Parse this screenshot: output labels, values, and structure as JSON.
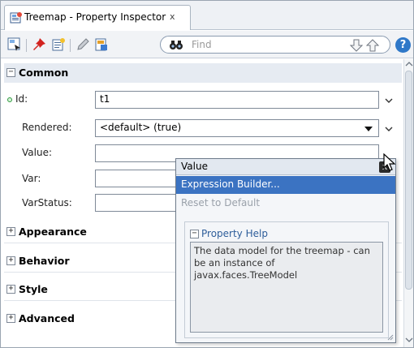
{
  "tab": {
    "title": "Treemap - Property Inspector",
    "close": "x",
    "icon": "property-inspector-icon"
  },
  "toolbar": {
    "icons": [
      "select-component-icon",
      "pin-icon",
      "edit-properties-icon",
      "pencil-icon",
      "bind-data-icon",
      "binoculars-icon"
    ],
    "search_placeholder": "Find",
    "help_label": "?"
  },
  "sections": {
    "common": "Common",
    "appearance": "Appearance",
    "behavior": "Behavior",
    "style": "Style",
    "advanced": "Advanced"
  },
  "properties": {
    "id": {
      "label": "Id:",
      "value": "t1"
    },
    "rendered": {
      "label": "Rendered:",
      "value": "<default> (true)"
    },
    "value": {
      "label": "Value:",
      "value": ""
    },
    "var": {
      "label": "Var:",
      "value": ""
    },
    "varstatus": {
      "label": "VarStatus:",
      "value": ""
    }
  },
  "popup": {
    "title": "Value",
    "close": "x",
    "menu": {
      "expression_builder": "Expression Builder...",
      "reset_default": "Reset to Default"
    },
    "help_title": "Property Help",
    "help_text": "The data model for the treemap - can be an instance of javax.faces.TreeModel"
  },
  "colors": {
    "accent": "#3b73c2",
    "required_dot": "#2e9a3f",
    "section_bg": "#e6ebf2"
  }
}
